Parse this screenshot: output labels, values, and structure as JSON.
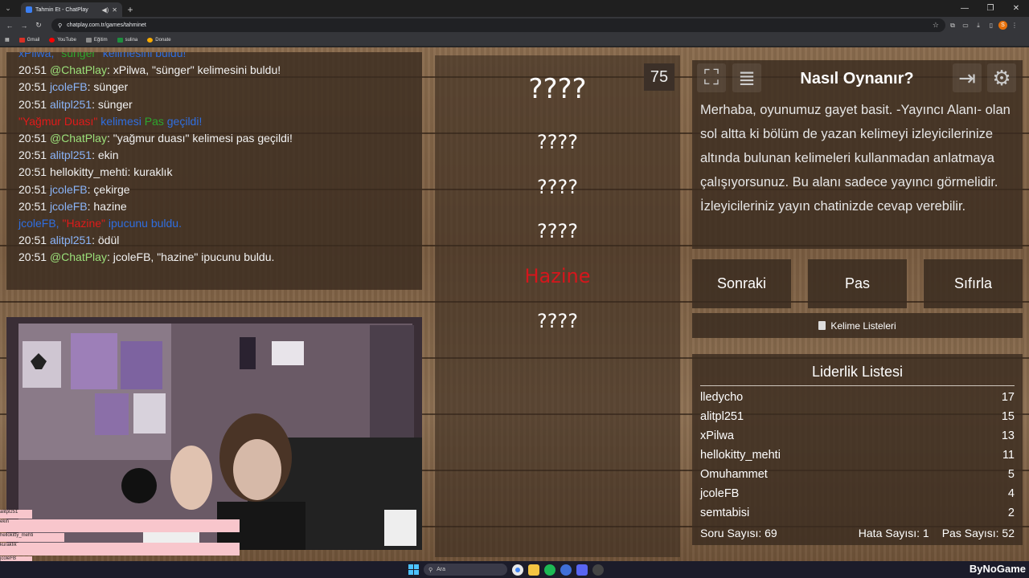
{
  "browser": {
    "tab_title": "Tahmin Et - ChatPlay",
    "url": "chatplay.com.tr/games/tahminet",
    "bookmarks": [
      {
        "label": "Gmail",
        "color": "#d93025"
      },
      {
        "label": "YouTube",
        "color": "#ff0000"
      },
      {
        "label": "Eğitim",
        "color": "#5f6368"
      },
      {
        "label": "sulina",
        "color": "#1e8e3e"
      },
      {
        "label": "Donate",
        "color": "#f9ab00"
      }
    ],
    "profile_initial": "S"
  },
  "chat": {
    "messages": [
      {
        "time": "",
        "user": "",
        "text": "xPilwa, \"sünger\" kelimesini buldu!",
        "kind": "partial"
      },
      {
        "time": "20:51",
        "user": "@ChatPlay",
        "text": ": xPilwa, \"sünger\" kelimesini buldu!",
        "kind": "bot"
      },
      {
        "time": "20:51",
        "user": "jcoleFB",
        "text": ": sünger",
        "kind": "lb"
      },
      {
        "time": "20:51",
        "user": "alitpl251",
        "text": ": sünger",
        "kind": "blue"
      },
      {
        "time": "",
        "user": "",
        "text": "\"Yağmur Duası\" kelimesi Pas geçildi!",
        "kind": "sys-pass"
      },
      {
        "time": "20:51",
        "user": "@ChatPlay",
        "text": ": \"yağmur duası\" kelimesi pas geçildi!",
        "kind": "bot"
      },
      {
        "time": "20:51",
        "user": "alitpl251",
        "text": ": ekin",
        "kind": "blue"
      },
      {
        "time": "20:51",
        "user": "hellokitty_mehti",
        "text": ": kuraklık",
        "kind": "white"
      },
      {
        "time": "20:51",
        "user": "jcoleFB",
        "text": ": çekirge",
        "kind": "lb"
      },
      {
        "time": "20:51",
        "user": "jcoleFB",
        "text": ": hazine",
        "kind": "lb"
      },
      {
        "time": "",
        "user": "",
        "text": "jcoleFB, \"Hazine\" ipucunu buldu.",
        "kind": "sys-hint"
      },
      {
        "time": "20:51",
        "user": "alitpl251",
        "text": ": ödül",
        "kind": "blue"
      },
      {
        "time": "20:51",
        "user": "@ChatPlay",
        "text": ": jcoleFB, \"hazine\" ipucunu buldu.",
        "kind": "bot"
      }
    ]
  },
  "game": {
    "timer": "75",
    "words": [
      "????",
      "????",
      "????",
      "????",
      "Hazine",
      "????"
    ]
  },
  "info": {
    "title": "Nasıl Oynanır?",
    "body": "Merhaba, oyunumuz gayet basit. -Yayıncı Alanı- olan sol altta ki bölüm de yazan kelimeyi izleyicilerinize altında bulunan kelimeleri kullanmadan anlatmaya çalışıyorsunuz. Bu alanı sadece yayıncı görmelidir. İzleyicileriniz yayın chatinizde cevap verebilir."
  },
  "controls": {
    "next": "Sonraki",
    "pass": "Pas",
    "reset": "Sıfırla",
    "word_lists": "Kelime Listeleri"
  },
  "leaderboard": {
    "title": "Liderlik Listesi",
    "rows": [
      {
        "name": "lledycho",
        "score": "17"
      },
      {
        "name": "alitpl251",
        "score": "15"
      },
      {
        "name": "xPilwa",
        "score": "13"
      },
      {
        "name": "hellokitty_mehti",
        "score": "11"
      },
      {
        "name": "Omuhammet",
        "score": "5"
      },
      {
        "name": "jcoleFB",
        "score": "4"
      },
      {
        "name": "semtabisi",
        "score": "2"
      }
    ],
    "question_count": "Soru Sayısı: 69",
    "error_count": "Hata Sayısı: 1",
    "pass_count": "Pas Sayısı: 52"
  },
  "overlay": {
    "lines": [
      "alitpl251",
      "ekin",
      "hellokitty_mehti",
      "kuraklık",
      "jcoleFB",
      "çekirge"
    ]
  },
  "taskbar": {
    "search_placeholder": "Ara",
    "watermark": "ByNoGame"
  }
}
